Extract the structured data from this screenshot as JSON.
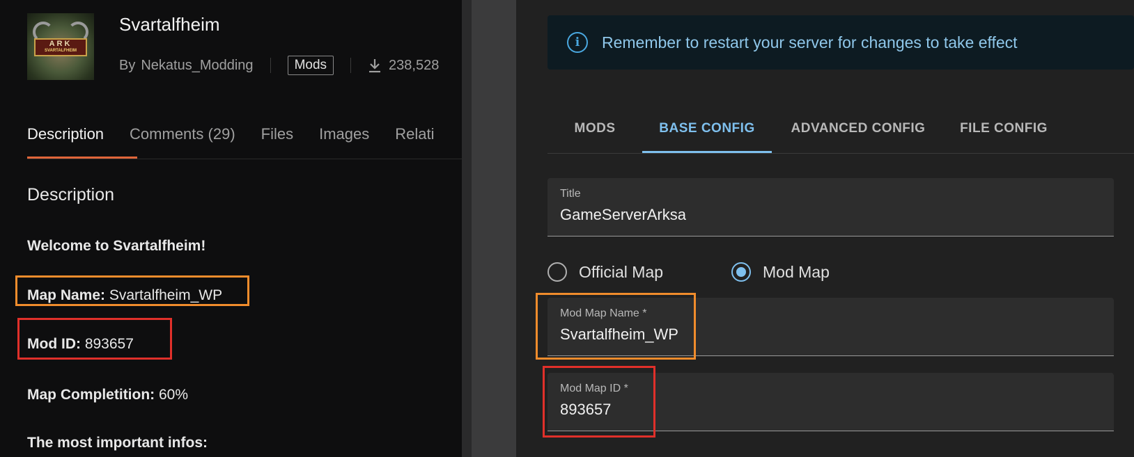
{
  "mod_page": {
    "thumbnail": {
      "logo_text": "ARK",
      "logo_subtext": "SVARTALFHEIM"
    },
    "title": "Svartalfheim",
    "by_label": "By",
    "author": "Nekatus_Modding",
    "category_tag": "Mods",
    "download_icon": "download-icon",
    "downloads": "238,528",
    "tabs": [
      {
        "label": "Description"
      },
      {
        "label": "Comments (29)"
      },
      {
        "label": "Files"
      },
      {
        "label": "Images"
      },
      {
        "label": "Relati"
      }
    ],
    "description": {
      "heading": "Description",
      "welcome": "Welcome to Svartalfheim!",
      "map_name_label": "Map Name:",
      "map_name_value": "Svartalfheim_WP",
      "mod_id_label": "Mod ID:",
      "mod_id_value": "893657",
      "completion_label": "Map Completition:",
      "completion_value": "60%",
      "infos_heading": "The most important infos:"
    }
  },
  "server_config": {
    "alert": {
      "icon": "info-icon",
      "message": "Remember to restart your server for changes to take effect"
    },
    "tabs": [
      {
        "label": "MODS"
      },
      {
        "label": "BASE CONFIG"
      },
      {
        "label": "ADVANCED CONFIG"
      },
      {
        "label": "FILE CONFIG"
      }
    ],
    "active_tab": "BASE CONFIG",
    "title_field": {
      "label": "Title",
      "value": "GameServerArksa"
    },
    "map_type": {
      "options": [
        {
          "label": "Official Map"
        },
        {
          "label": "Mod Map"
        }
      ],
      "selected": "Mod Map"
    },
    "mod_map_name_field": {
      "label": "Mod Map Name *",
      "value": "Svartalfheim_WP"
    },
    "mod_map_id_field": {
      "label": "Mod Map ID *",
      "value": "893657"
    }
  },
  "colors": {
    "highlight_orange": "#f08c2c",
    "highlight_red": "#e0302a",
    "accent_blue": "#7fc0ee",
    "tab_underline_orange": "#e0663a"
  }
}
